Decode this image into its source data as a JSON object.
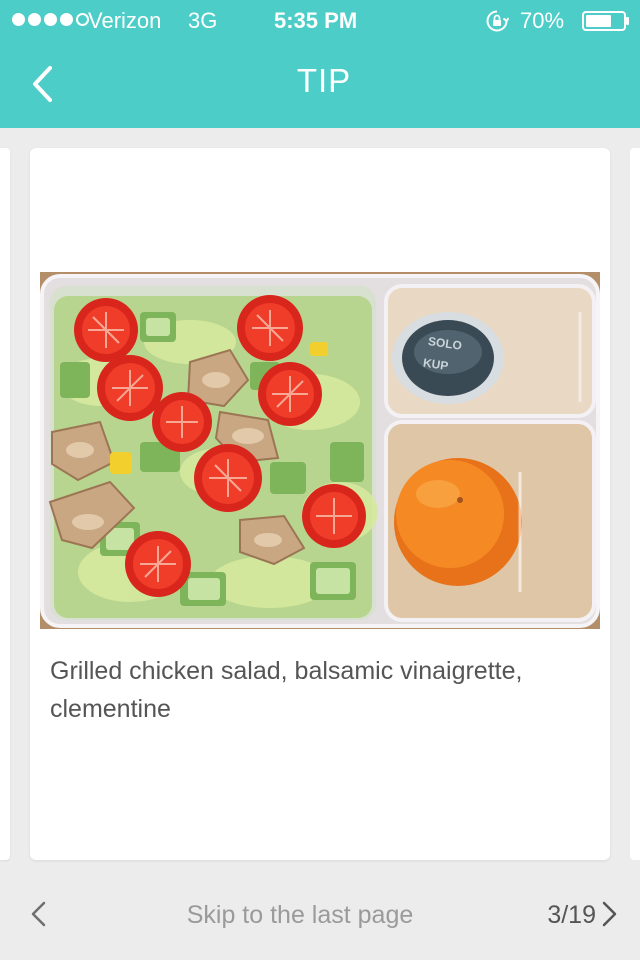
{
  "status_bar": {
    "signal_filled": 4,
    "signal_total": 5,
    "carrier": "Verizon",
    "network": "3G",
    "time": "5:35 PM",
    "battery_percent": "70%",
    "battery_level": 0.7
  },
  "nav": {
    "title": "TIP",
    "back_icon": "chevron-left-icon"
  },
  "tip_card": {
    "image_subject": "lunch-box-salad",
    "caption": "Grilled chicken salad, balsamic vinaigrette, clementine"
  },
  "footer": {
    "skip_label": "Skip to the last page",
    "page_counter": "3/19"
  },
  "colors": {
    "header_teal": "#4ccdc7",
    "background": "#ececec",
    "card": "#ffffff",
    "caption_text": "#555555",
    "muted_text": "#9a9a9a"
  }
}
